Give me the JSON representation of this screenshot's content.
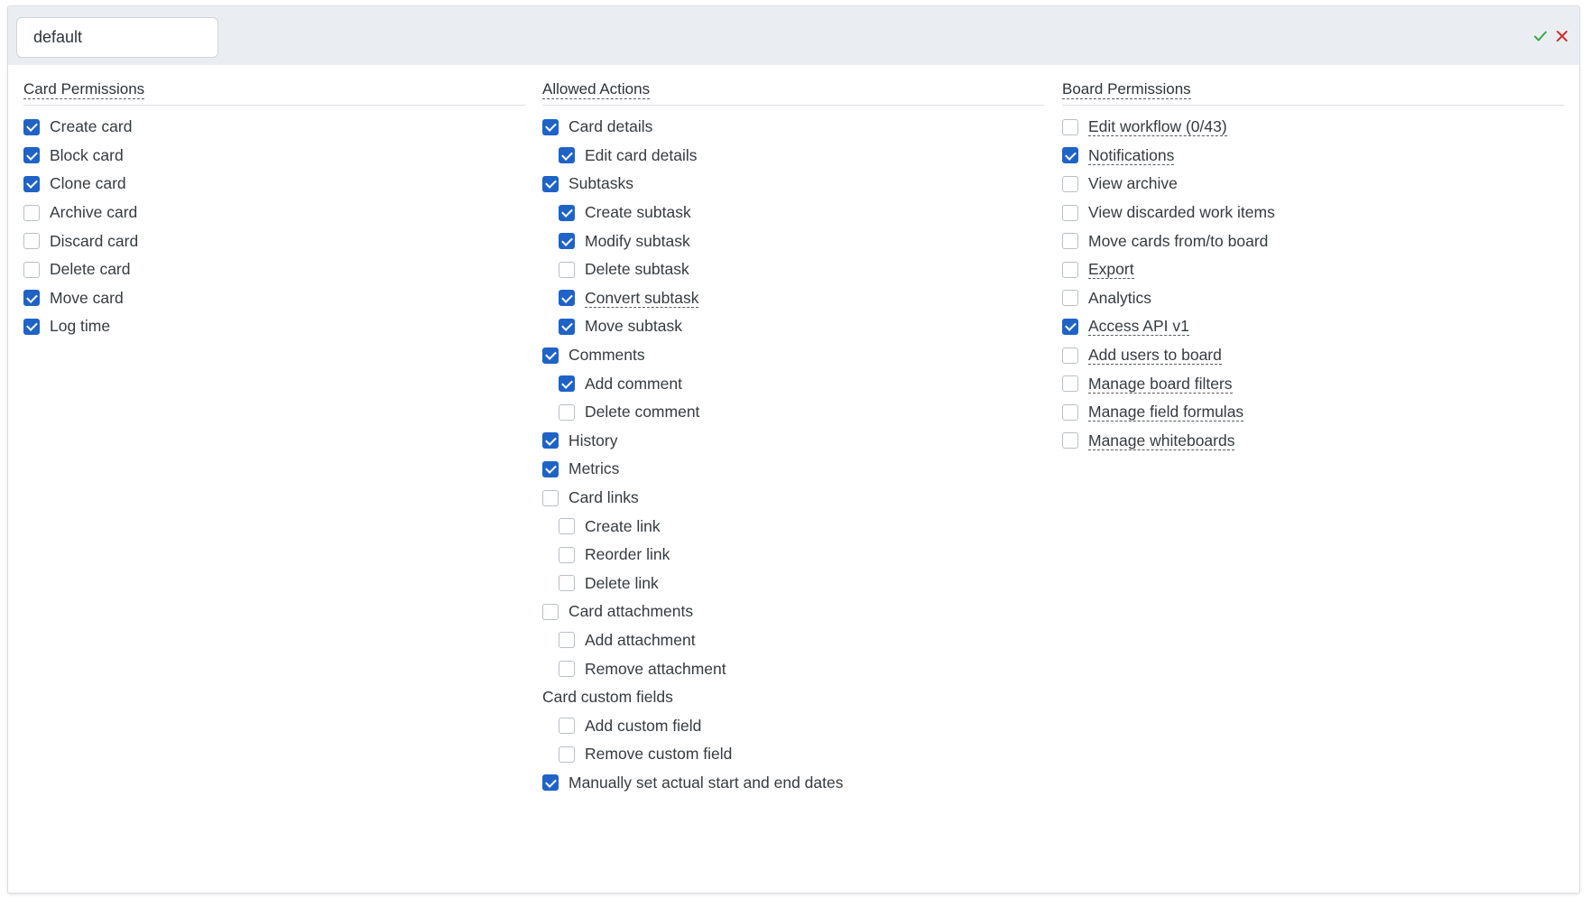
{
  "header": {
    "name_value": "default",
    "confirm_icon": "check-icon",
    "cancel_icon": "close-icon",
    "confirm_color": "#3aa845",
    "cancel_color": "#d0302f"
  },
  "colors": {
    "checkbox_checked": "#1f63c6",
    "header_bg": "#eaeef2"
  },
  "card_permissions": {
    "title": "Card Permissions",
    "items": [
      {
        "label": "Create card",
        "checked": true
      },
      {
        "label": "Block card",
        "checked": true
      },
      {
        "label": "Clone card",
        "checked": true
      },
      {
        "label": "Archive card",
        "checked": false
      },
      {
        "label": "Discard card",
        "checked": false
      },
      {
        "label": "Delete card",
        "checked": false
      },
      {
        "label": "Move card",
        "checked": true
      },
      {
        "label": "Log time",
        "checked": true
      }
    ]
  },
  "allowed_actions": {
    "title": "Allowed Actions",
    "items": [
      {
        "label": "Card details",
        "checked": true
      },
      {
        "label": "Edit card details",
        "checked": true
      },
      {
        "label": "Subtasks",
        "checked": true
      },
      {
        "label": "Create subtask",
        "checked": true
      },
      {
        "label": "Modify subtask",
        "checked": true
      },
      {
        "label": "Delete subtask",
        "checked": false
      },
      {
        "label": "Convert subtask",
        "checked": true
      },
      {
        "label": "Move subtask",
        "checked": true
      },
      {
        "label": "Comments",
        "checked": true
      },
      {
        "label": "Add comment",
        "checked": true
      },
      {
        "label": "Delete comment",
        "checked": false
      },
      {
        "label": "History",
        "checked": true
      },
      {
        "label": "Metrics",
        "checked": true
      },
      {
        "label": "Card links",
        "checked": false
      },
      {
        "label": "Create link",
        "checked": false
      },
      {
        "label": "Reorder link",
        "checked": false
      },
      {
        "label": "Delete link",
        "checked": false
      },
      {
        "label": "Card attachments",
        "checked": false
      },
      {
        "label": "Add attachment",
        "checked": false
      },
      {
        "label": "Remove attachment",
        "checked": false
      },
      {
        "label": "Card custom fields"
      },
      {
        "label": "Add custom field",
        "checked": false
      },
      {
        "label": "Remove custom field",
        "checked": false
      },
      {
        "label": "Manually set actual start and end dates",
        "checked": true
      }
    ]
  },
  "board_permissions": {
    "title": "Board Permissions",
    "items": [
      {
        "label": "Edit workflow (0/43)",
        "checked": false
      },
      {
        "label": "Notifications",
        "checked": true
      },
      {
        "label": "View archive",
        "checked": false
      },
      {
        "label": "View discarded work items",
        "checked": false
      },
      {
        "label": "Move cards from/to board",
        "checked": false
      },
      {
        "label": "Export",
        "checked": false
      },
      {
        "label": "Analytics",
        "checked": false
      },
      {
        "label": "Access API v1",
        "checked": true
      },
      {
        "label": "Add users to board",
        "checked": false
      },
      {
        "label": "Manage board filters",
        "checked": false
      },
      {
        "label": "Manage field formulas",
        "checked": false
      },
      {
        "label": "Manage whiteboards",
        "checked": false
      }
    ]
  }
}
